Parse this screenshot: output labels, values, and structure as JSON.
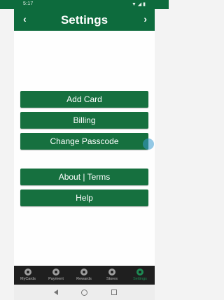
{
  "status": {
    "time": "5:17",
    "left_icons": "◉ ▢",
    "right_icons": "▼ ◢ ▮"
  },
  "header": {
    "title": "Settings",
    "back_glyph": "‹",
    "forward_glyph": "›"
  },
  "buttons": [
    {
      "label": "Add Card"
    },
    {
      "label": "Billing"
    },
    {
      "label": "Change Passcode"
    },
    {
      "label": "About | Terms"
    },
    {
      "label": "Help"
    }
  ],
  "tabs": [
    {
      "label": "MyCards",
      "active": false
    },
    {
      "label": "Payment",
      "active": false
    },
    {
      "label": "Rewards",
      "active": false
    },
    {
      "label": "Stores",
      "active": false
    },
    {
      "label": "Settings",
      "active": true
    }
  ],
  "colors": {
    "brand_green": "#0d6b3d",
    "button_green": "#16703f",
    "tab_bar": "#1f1f1f",
    "active_tab": "#1e8a54"
  }
}
